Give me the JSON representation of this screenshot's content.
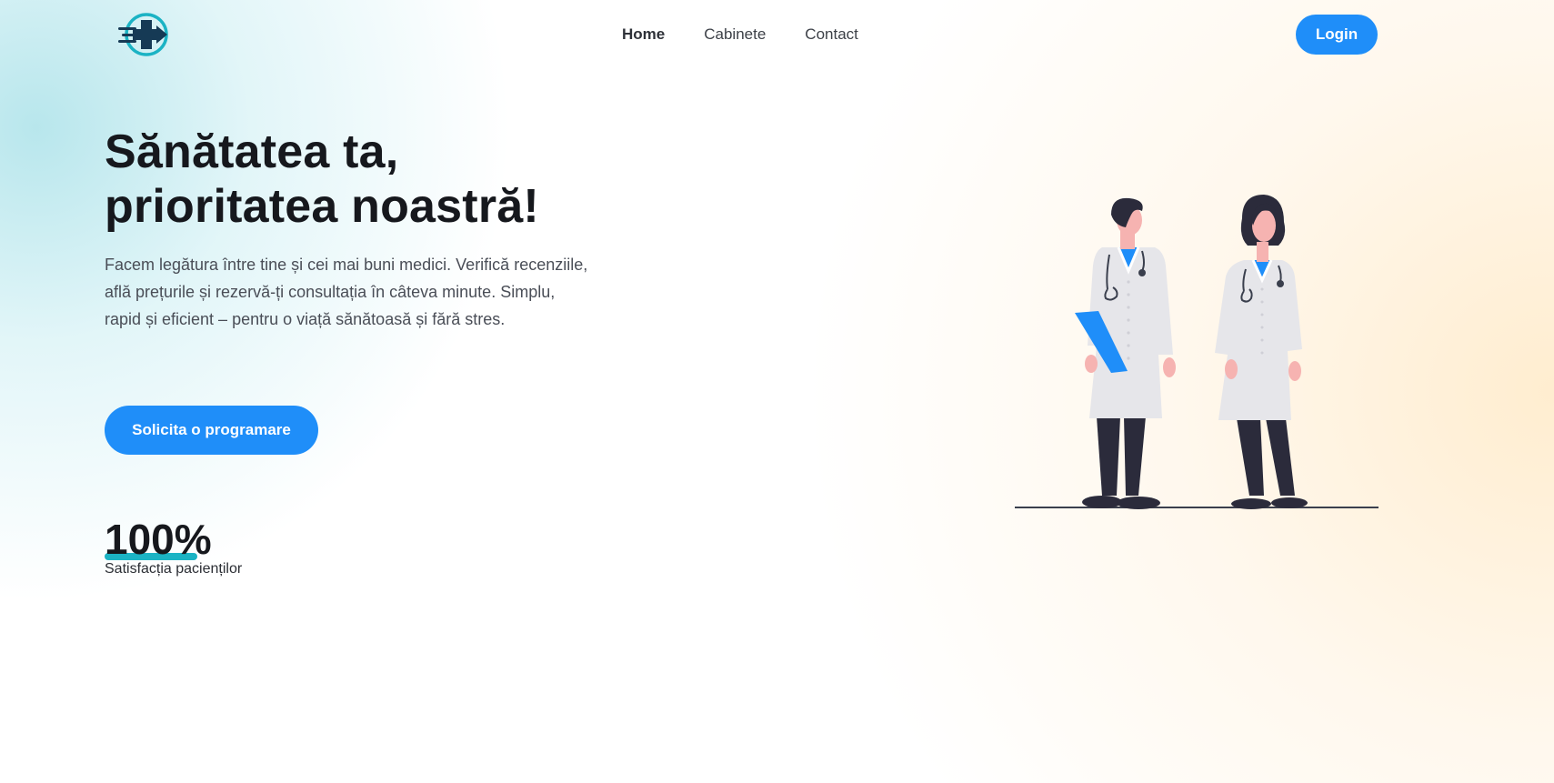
{
  "nav": {
    "logo_icon": "medical-cross-arrow-icon",
    "links": [
      "Home",
      "Cabinete",
      "Contact"
    ],
    "active_link": "Home",
    "login_label": "Login"
  },
  "hero": {
    "title_lines": [
      "Sănătatea ta,",
      "prioritatea noastră!"
    ],
    "description_lines": [
      "Facem legătura între tine și cei mai buni medici. Verifică recenziile,",
      "află prețurile și rezervă-ți consultația în câteva minute. Simplu,",
      "rapid și eficient – pentru o viață sănătoasă și fără stres."
    ],
    "cta_label": "Solicita o programare"
  },
  "stat": {
    "value": "100%",
    "label": "Satisfacția pacienților"
  },
  "colors": {
    "accent": "#1f8ef9",
    "teal": "#1bb3c4",
    "logo_dark": "#163a55"
  }
}
